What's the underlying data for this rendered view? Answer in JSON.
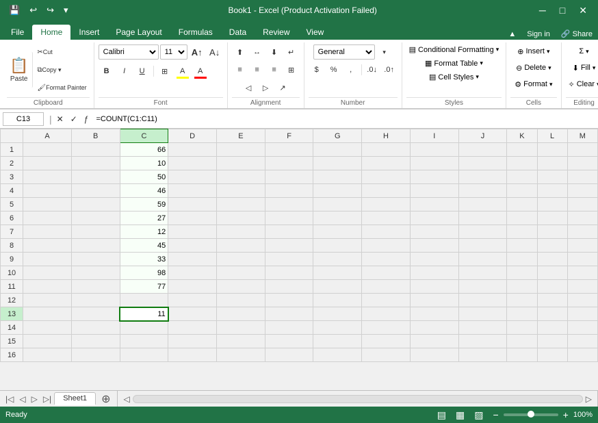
{
  "titleBar": {
    "title": "Book1 - Excel (Product Activation Failed)",
    "quickAccess": [
      "💾",
      "↩",
      "↪",
      "▾"
    ]
  },
  "ribbon": {
    "tabs": [
      "File",
      "Home",
      "Insert",
      "Page Layout",
      "Formulas",
      "Data",
      "Review",
      "View"
    ],
    "activeTab": "Home",
    "groups": {
      "clipboard": {
        "label": "Clipboard",
        "paste_label": "Paste",
        "cut_label": "✂",
        "copy_label": "⧉",
        "format_painter_label": "🖌"
      },
      "font": {
        "label": "Font",
        "fontName": "Calibri",
        "fontSize": "11",
        "boldLabel": "B",
        "italicLabel": "I",
        "underlineLabel": "U",
        "bordersLabel": "⊞",
        "fillLabel": "A",
        "colorLabel": "A"
      },
      "alignment": {
        "label": "Alignment"
      },
      "number": {
        "label": "Number",
        "format": "General"
      },
      "styles": {
        "label": "Styles",
        "conditionalFormatting": "Conditional Formatting",
        "formatTable": "Format Table",
        "cellStyles": "Cell Styles"
      },
      "cells": {
        "label": "Cells",
        "insert": "Insert",
        "delete": "Delete",
        "format": "Format"
      },
      "editing": {
        "label": "Editing"
      }
    }
  },
  "formulaBar": {
    "cellRef": "C13",
    "formula": "=COUNT(C1:C11)"
  },
  "grid": {
    "columns": [
      "",
      "A",
      "B",
      "C",
      "D",
      "E",
      "F",
      "G",
      "H",
      "I",
      "J",
      "K",
      "L",
      "M"
    ],
    "activeCell": "C13",
    "rows": [
      {
        "num": 1,
        "c": "66"
      },
      {
        "num": 2,
        "c": "10"
      },
      {
        "num": 3,
        "c": "50"
      },
      {
        "num": 4,
        "c": "46"
      },
      {
        "num": 5,
        "c": "59"
      },
      {
        "num": 6,
        "c": "27"
      },
      {
        "num": 7,
        "c": "12"
      },
      {
        "num": 8,
        "c": "45"
      },
      {
        "num": 9,
        "c": "33"
      },
      {
        "num": 10,
        "c": "98"
      },
      {
        "num": 11,
        "c": "77"
      },
      {
        "num": 12,
        "c": ""
      },
      {
        "num": 13,
        "c": "11"
      },
      {
        "num": 14,
        "c": ""
      },
      {
        "num": 15,
        "c": ""
      },
      {
        "num": 16,
        "c": ""
      }
    ]
  },
  "sheetTabs": {
    "sheets": [
      "Sheet1"
    ],
    "activeSheet": "Sheet1"
  },
  "statusBar": {
    "status": "Ready",
    "zoom": "100%"
  }
}
